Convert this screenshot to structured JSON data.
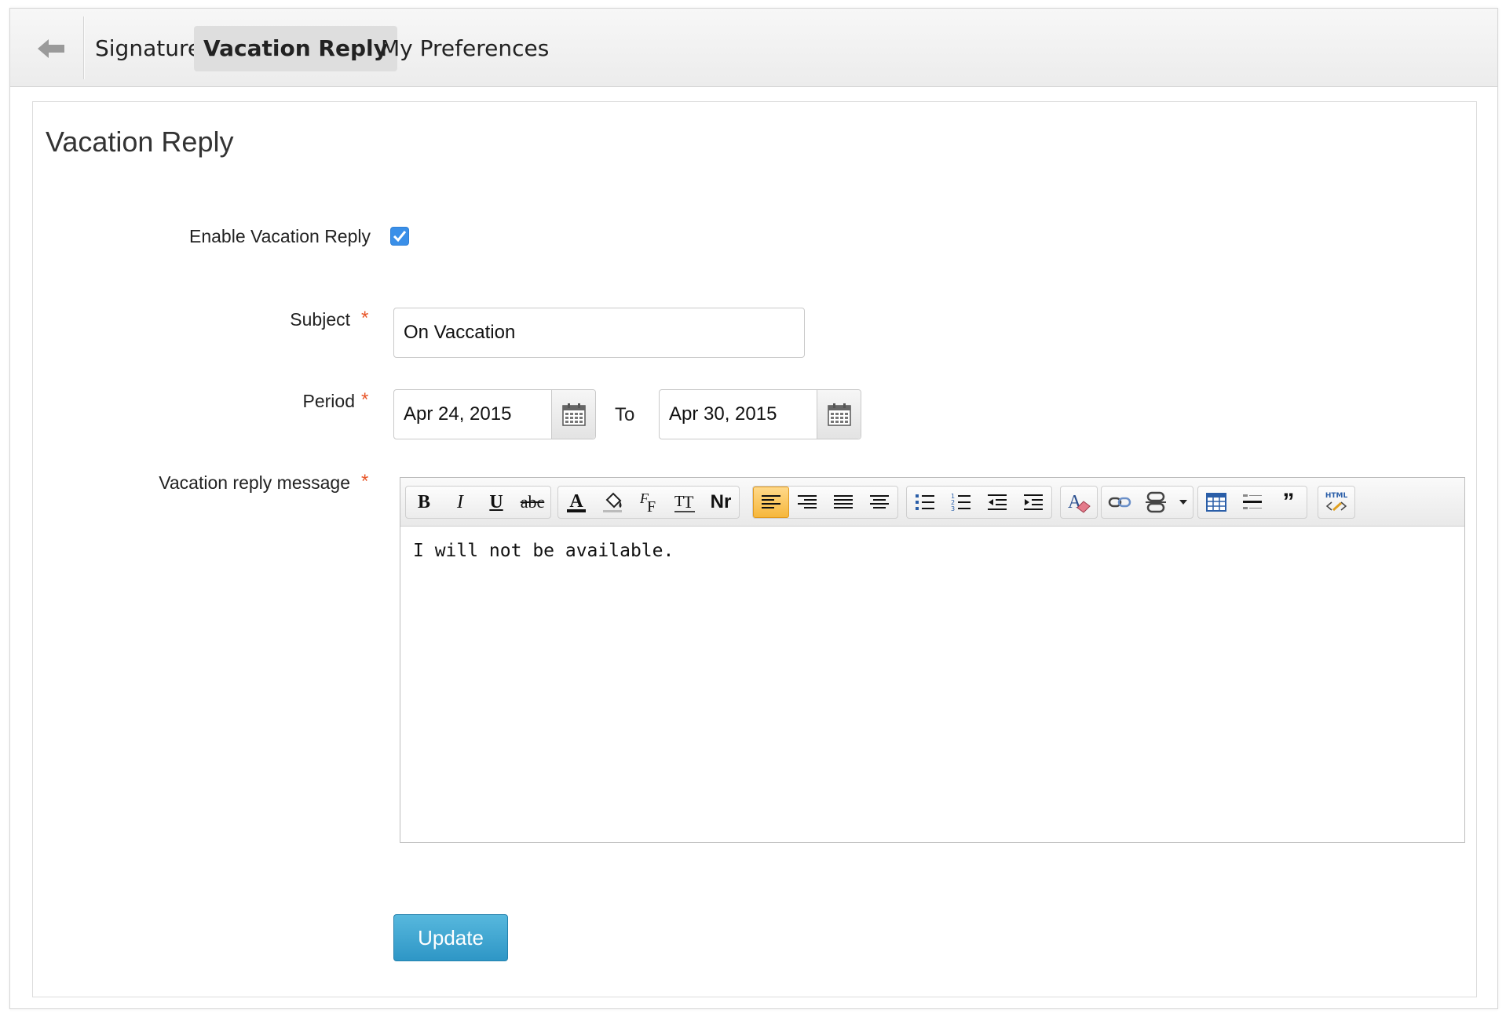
{
  "tabs": [
    {
      "label": "Signature"
    },
    {
      "label": "Vacation Reply"
    },
    {
      "label": "My Preferences"
    }
  ],
  "page_title": "Vacation Reply",
  "form": {
    "enable_label": "Enable Vacation Reply",
    "enabled": true,
    "subject_label": "Subject",
    "subject_value": "On Vaccation",
    "period_label": "Period",
    "period_from": "Apr 24, 2015",
    "period_to_label": "To",
    "period_to": "Apr 30, 2015",
    "message_label": "Vacation reply message",
    "message_text": "I will not be available.",
    "required_mark": "*"
  },
  "toolbar": {
    "bold": "B",
    "italic": "I",
    "underline": "U",
    "strike": "abc",
    "normal": "Nr",
    "quote": "”",
    "html": "HTML"
  },
  "update_label": "Update",
  "colors": {
    "accent": "#2e96c6",
    "required": "#e8572a",
    "checkbox": "#3a8fe8"
  }
}
